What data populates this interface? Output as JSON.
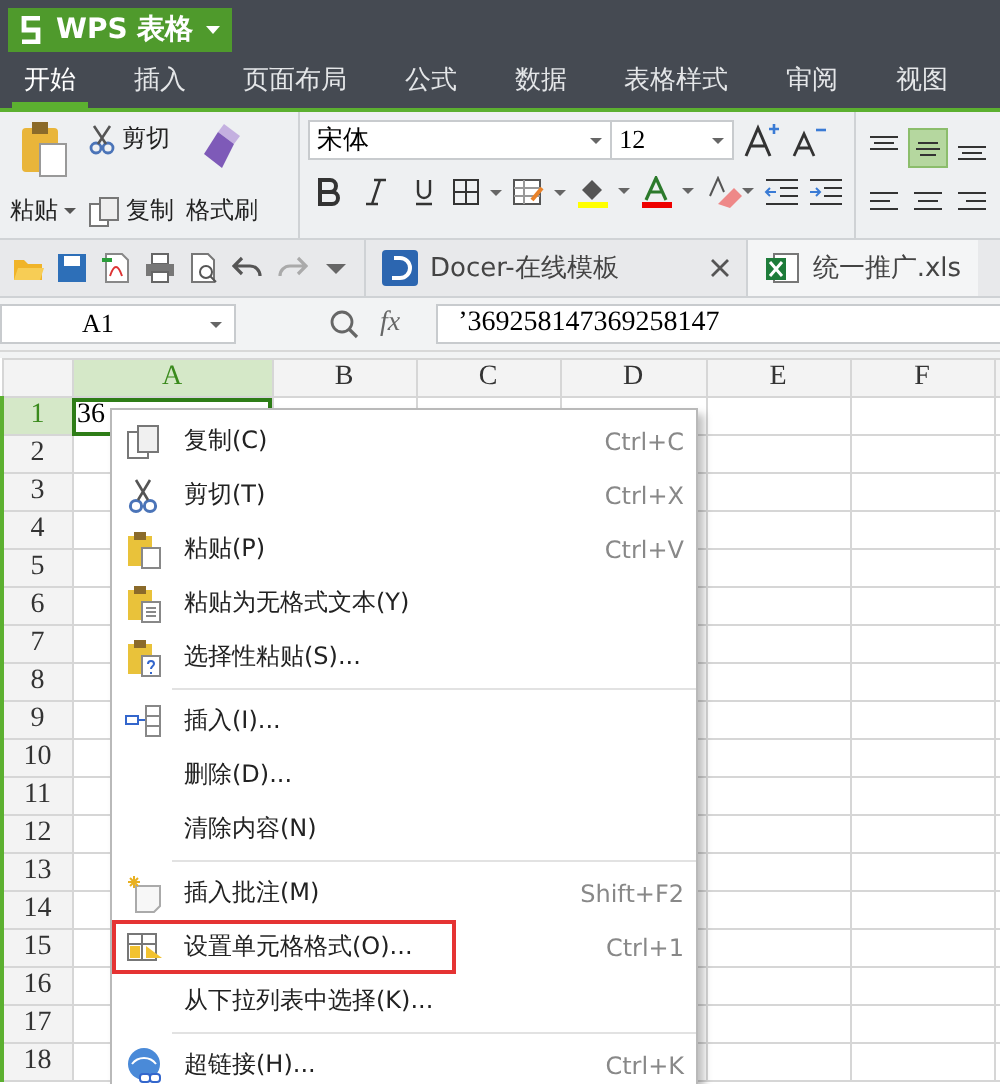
{
  "app_button": {
    "label": "WPS 表格"
  },
  "tabs": [
    {
      "label": "开始",
      "selected": true
    },
    {
      "label": "插入",
      "selected": false
    },
    {
      "label": "页面布局",
      "selected": false
    },
    {
      "label": "公式",
      "selected": false
    },
    {
      "label": "数据",
      "selected": false
    },
    {
      "label": "表格样式",
      "selected": false
    },
    {
      "label": "审阅",
      "selected": false
    },
    {
      "label": "视图",
      "selected": false
    }
  ],
  "clipboard": {
    "paste": "粘贴",
    "cut": "剪切",
    "copy": "复制",
    "format_painter": "格式刷"
  },
  "font": {
    "name": "宋体",
    "size": "12",
    "bold": false,
    "italic": false,
    "underline": false
  },
  "alignment": [
    {
      "selected": false
    },
    {
      "selected": true
    },
    {
      "selected": false
    },
    {
      "selected": false
    },
    {
      "selected": false
    },
    {
      "selected": false
    }
  ],
  "documents": [
    {
      "title": "Docer-在线模板",
      "kind": "docer",
      "selected": false
    },
    {
      "title": "统一推广.xls",
      "kind": "sheet",
      "selected": true
    }
  ],
  "formula_bar": {
    "name_box": "A1",
    "fx": "fx",
    "value": "’369258147369258147"
  },
  "sheet": {
    "columns": [
      {
        "label": "A",
        "selected": true
      },
      {
        "label": "B",
        "selected": false
      },
      {
        "label": "C",
        "selected": false
      },
      {
        "label": "D",
        "selected": false
      },
      {
        "label": "E",
        "selected": false
      },
      {
        "label": "F",
        "selected": false
      }
    ],
    "rows": [
      {
        "label": "1",
        "selected": true
      },
      {
        "label": "2",
        "selected": false
      },
      {
        "label": "3",
        "selected": false
      },
      {
        "label": "4",
        "selected": false
      },
      {
        "label": "5",
        "selected": false
      },
      {
        "label": "6",
        "selected": false
      },
      {
        "label": "7",
        "selected": false
      },
      {
        "label": "8",
        "selected": false
      },
      {
        "label": "9",
        "selected": false
      },
      {
        "label": "10",
        "selected": false
      },
      {
        "label": "11",
        "selected": false
      },
      {
        "label": "12",
        "selected": false
      },
      {
        "label": "13",
        "selected": false
      },
      {
        "label": "14",
        "selected": false
      },
      {
        "label": "15",
        "selected": false
      },
      {
        "label": "16",
        "selected": false
      },
      {
        "label": "17",
        "selected": false
      },
      {
        "label": "18",
        "selected": false
      }
    ],
    "a1_value": "36"
  },
  "context_menu": [
    {
      "label": "复制(C)",
      "shortcut": "Ctrl+C",
      "highlighted": false
    },
    {
      "label": "剪切(T)",
      "shortcut": "Ctrl+X",
      "separator_before": false,
      "highlighted": false
    },
    {
      "label": "粘贴(P)",
      "shortcut": "Ctrl+V",
      "separator_before": false,
      "highlighted": false
    },
    {
      "label": "粘贴为无格式文本(Y)",
      "separator_before": false,
      "highlighted": false
    },
    {
      "label": "选择性粘贴(S)...",
      "separator_before": false,
      "highlighted": false
    },
    {
      "label": "插入(I)...",
      "separator_before": true,
      "highlighted": false
    },
    {
      "label": "删除(D)...",
      "separator_before": false,
      "highlighted": false
    },
    {
      "label": "清除内容(N)",
      "separator_before": false,
      "highlighted": false
    },
    {
      "label": "插入批注(M)",
      "shortcut": "Shift+F2",
      "separator_before": true,
      "highlighted": false
    },
    {
      "label": "设置单元格格式(O)...",
      "shortcut": "Ctrl+1",
      "separator_before": false,
      "highlighted": true
    },
    {
      "label": "从下拉列表中选择(K)...",
      "separator_before": false,
      "highlighted": false
    },
    {
      "label": "超链接(H)...",
      "shortcut": "Ctrl+K",
      "separator_before": true,
      "highlighted": false
    }
  ]
}
